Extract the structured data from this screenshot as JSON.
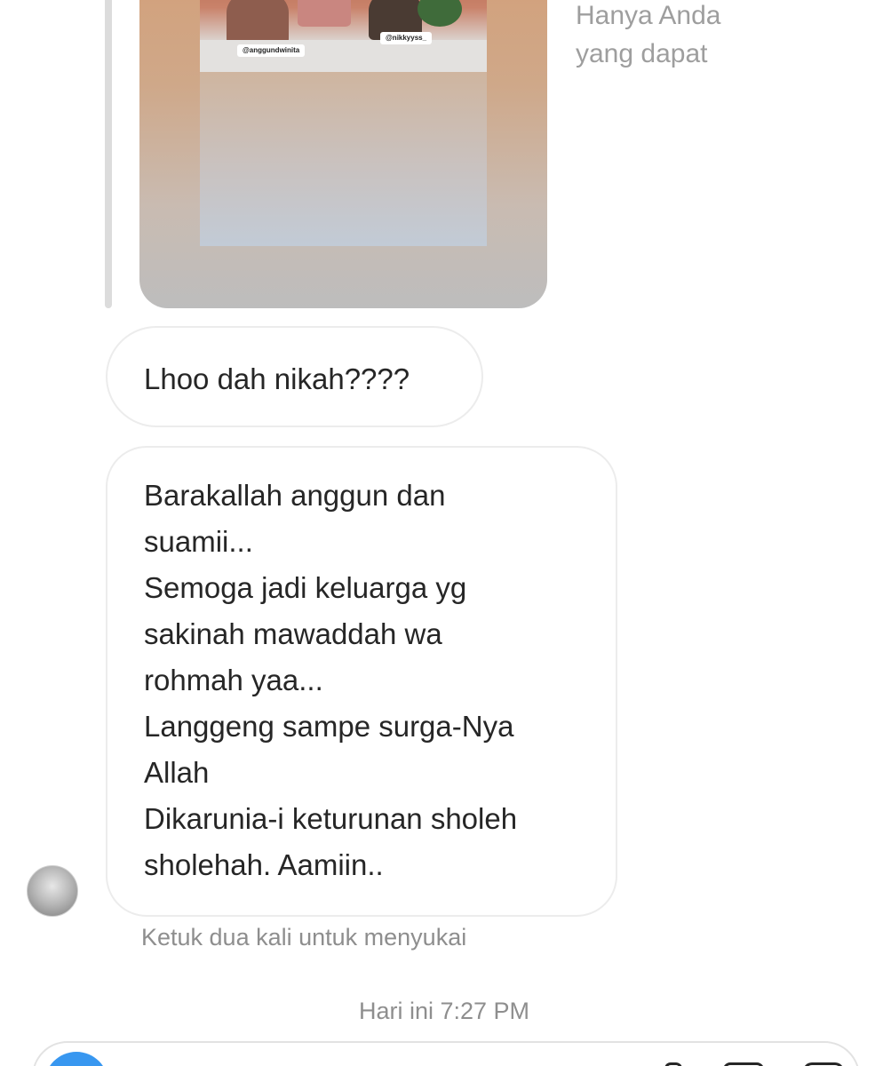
{
  "shared_story": {
    "tag_left": "@anggundwinita",
    "tag_right": "@nikkyyss_",
    "visibility_note": "Hanya Anda yang dapat"
  },
  "messages": [
    {
      "lines": [
        "Lhoo dah nikah????"
      ]
    },
    {
      "lines": [
        "Barakallah anggun dan",
        "suamii...",
        "Semoga jadi keluarga yg",
        "sakinah mawaddah wa",
        "rohmah yaa...",
        "Langgeng sampe surga-Nya",
        "Allah",
        "Dikarunia-i keturunan sholeh",
        "sholehah. Aamiin.."
      ]
    }
  ],
  "hint": "Ketuk dua kali untuk menyukai",
  "timestamp": "Hari ini 7:27 PM",
  "composer": {
    "camera_icon": "camera-icon",
    "mic_icon": "mic-icon",
    "gallery_icon": "gallery-icon",
    "sticker_icon": "sticker-icon",
    "accent_color": "#3897f0"
  }
}
